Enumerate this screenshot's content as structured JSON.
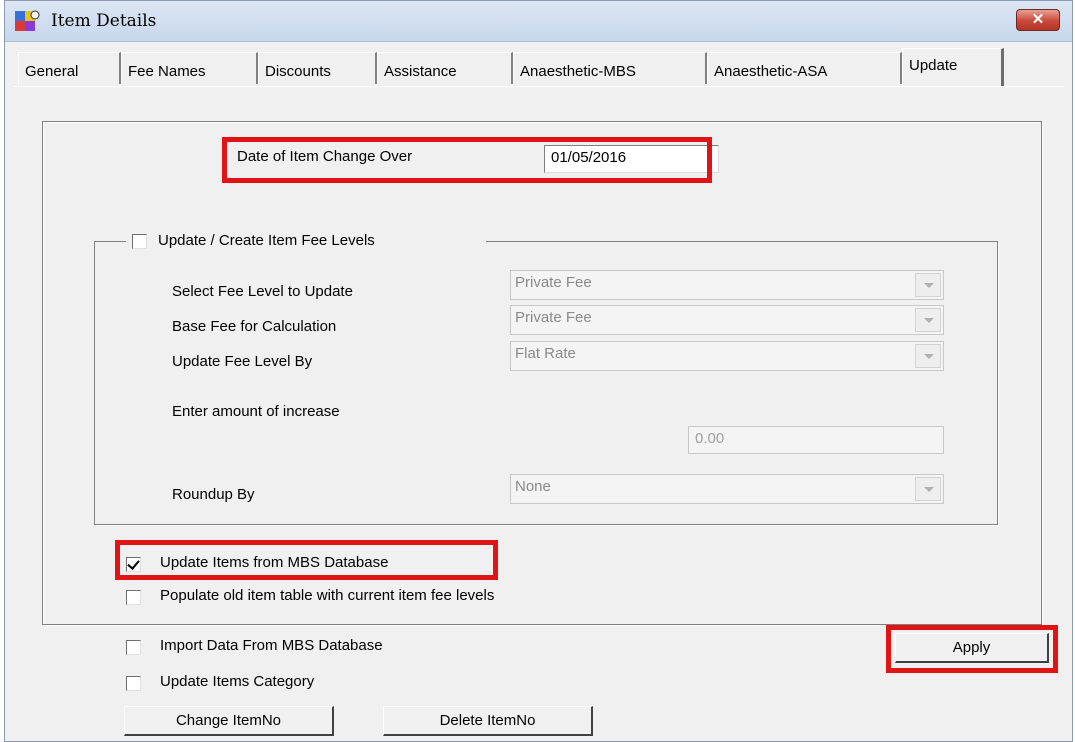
{
  "window": {
    "title": "Item Details",
    "close_label": "✕"
  },
  "tabs": [
    {
      "label": "General"
    },
    {
      "label": "Fee Names"
    },
    {
      "label": "Discounts"
    },
    {
      "label": "Assistance"
    },
    {
      "label": "Anaesthetic-MBS"
    },
    {
      "label": "Anaesthetic-ASA"
    },
    {
      "label": "Update"
    }
  ],
  "active_tab": "Update",
  "change_over": {
    "label": "Date of Item Change Over",
    "value": "01/05/2016"
  },
  "fee_levels": {
    "group_label": "Update / Create Item Fee Levels",
    "checked": false,
    "select_fee_level": {
      "label": "Select Fee Level to Update",
      "value": "Private Fee"
    },
    "base_fee": {
      "label": "Base Fee for Calculation",
      "value": "Private Fee"
    },
    "update_by": {
      "label": "Update Fee Level By",
      "value": "Flat Rate"
    },
    "increase": {
      "label": "Enter amount of increase",
      "value": "0.00"
    },
    "roundup": {
      "label": "Roundup By",
      "value": "None"
    }
  },
  "options": {
    "update_from_mbs": {
      "label": "Update Items from MBS Database",
      "checked": true
    },
    "populate_old": {
      "label": "Populate old item table with current item fee levels",
      "checked": false
    },
    "import_data": {
      "label": "Import Data From MBS Database",
      "checked": false
    },
    "update_category": {
      "label": "Update Items Category",
      "checked": false
    }
  },
  "buttons": {
    "apply": "Apply",
    "change_itemno": "Change ItemNo",
    "delete_itemno": "Delete ItemNo"
  },
  "colors": {
    "highlight": "#e01414",
    "titlebar": "#c7d7ec",
    "close": "#c7493a"
  }
}
